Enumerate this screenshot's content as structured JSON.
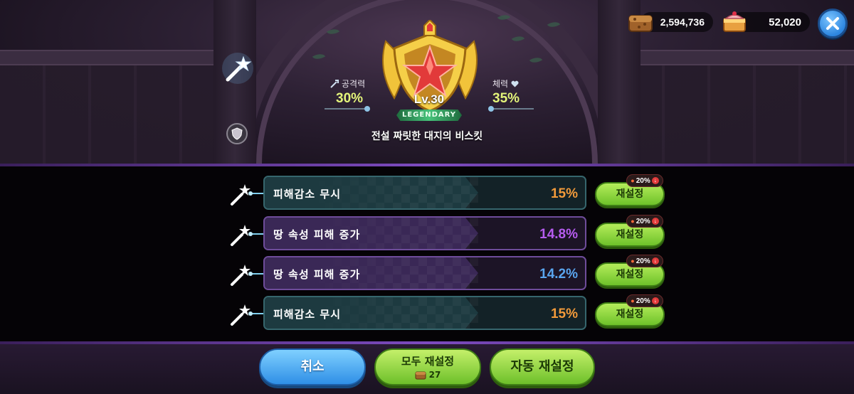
{
  "currency": {
    "coins_value": "2,594,736",
    "crystals_value": "52,020"
  },
  "topping": {
    "level": "Lv.30",
    "grade": "LEGENDARY",
    "name": "전설 짜릿한 대지의 비스킷",
    "attack_label": "공격력",
    "attack_value": "30%",
    "hp_label": "체력",
    "hp_value": "35%"
  },
  "options": [
    {
      "name": "피해감소 무시",
      "value": "15%",
      "value_color": "#f29a3a",
      "reset_label": "재설정",
      "cost_badge": "20%"
    },
    {
      "name": "땅 속성 피해 증가",
      "value": "14.8%",
      "value_color": "#b65cf0",
      "reset_label": "재설정",
      "cost_badge": "20%"
    },
    {
      "name": "땅 속성 피해 증가",
      "value": "14.2%",
      "value_color": "#5aa6f0",
      "reset_label": "재설정",
      "cost_badge": "20%"
    },
    {
      "name": "피해감소 무시",
      "value": "15%",
      "value_color": "#f29a3a",
      "reset_label": "재설정",
      "cost_badge": "20%"
    }
  ],
  "buttons": {
    "cancel_label": "취소",
    "reset_all_label": "모두 재설정",
    "reset_all_cost": "27",
    "auto_reset_label": "자동 재설정"
  },
  "icons": {
    "coins": "treasure-chest-icon",
    "crystals": "cake-crystal-icon",
    "close": "close-icon",
    "wand": "magic-wand-icon",
    "attack": "sword-icon",
    "hp": "heart-icon"
  }
}
